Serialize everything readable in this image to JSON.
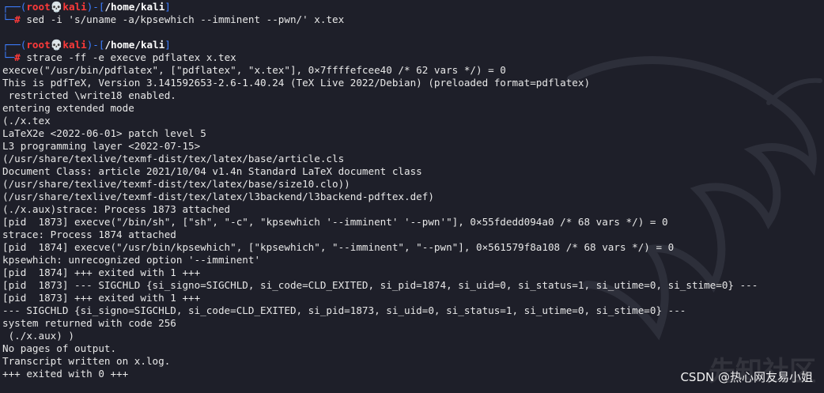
{
  "prompt1": {
    "user": "root",
    "skull": "💀",
    "host": "kali",
    "path": "/home/kali",
    "command": "sed -i 's/uname -a/kpsewhich --imminent --pwn/' x.tex"
  },
  "prompt2": {
    "user": "root",
    "skull": "💀",
    "host": "kali",
    "path": "/home/kali",
    "command": "strace -ff -e execve pdflatex x.tex"
  },
  "output": [
    "execve(\"/usr/bin/pdflatex\", [\"pdflatex\", \"x.tex\"], 0×7ffffefcee40 /* 62 vars */) = 0",
    "This is pdfTeX, Version 3.141592653-2.6-1.40.24 (TeX Live 2022/Debian) (preloaded format=pdflatex)",
    " restricted \\write18 enabled.",
    "entering extended mode",
    "(./x.tex",
    "LaTeX2e <2022-06-01> patch level 5",
    "L3 programming layer <2022-07-15>",
    "(/usr/share/texlive/texmf-dist/tex/latex/base/article.cls",
    "Document Class: article 2021/10/04 v1.4n Standard LaTeX document class",
    "(/usr/share/texlive/texmf-dist/tex/latex/base/size10.clo))",
    "(/usr/share/texlive/texmf-dist/tex/latex/l3backend/l3backend-pdftex.def)",
    "(./x.aux)strace: Process 1873 attached",
    "[pid  1873] execve(\"/bin/sh\", [\"sh\", \"-c\", \"kpsewhich '--imminent' '--pwn'\"], 0×55fdedd094a0 /* 68 vars */) = 0",
    "strace: Process 1874 attached",
    "[pid  1874] execve(\"/usr/bin/kpsewhich\", [\"kpsewhich\", \"--imminent\", \"--pwn\"], 0×561579f8a108 /* 68 vars */) = 0",
    "kpsewhich: unrecognized option '--imminent'",
    "[pid  1874] +++ exited with 1 +++",
    "[pid  1873] --- SIGCHLD {si_signo=SIGCHLD, si_code=CLD_EXITED, si_pid=1874, si_uid=0, si_status=1, si_utime=0, si_stime=0} ---",
    "[pid  1873] +++ exited with 1 +++",
    "--- SIGCHLD {si_signo=SIGCHLD, si_code=CLD_EXITED, si_pid=1873, si_uid=0, si_status=1, si_utime=0, si_stime=0} ---",
    "system returned with code 256",
    " (./x.aux) )",
    "No pages of output.",
    "Transcript written on x.log.",
    "+++ exited with 0 +++"
  ],
  "watermark": {
    "label": "CSDN @热心网友易小姐",
    "background_text": "先知社区"
  },
  "colors": {
    "background": "#1e1f29",
    "prompt_frame": "#3d7eff",
    "prompt_user": "#ff3a3a",
    "text": "#e8e8e8"
  }
}
